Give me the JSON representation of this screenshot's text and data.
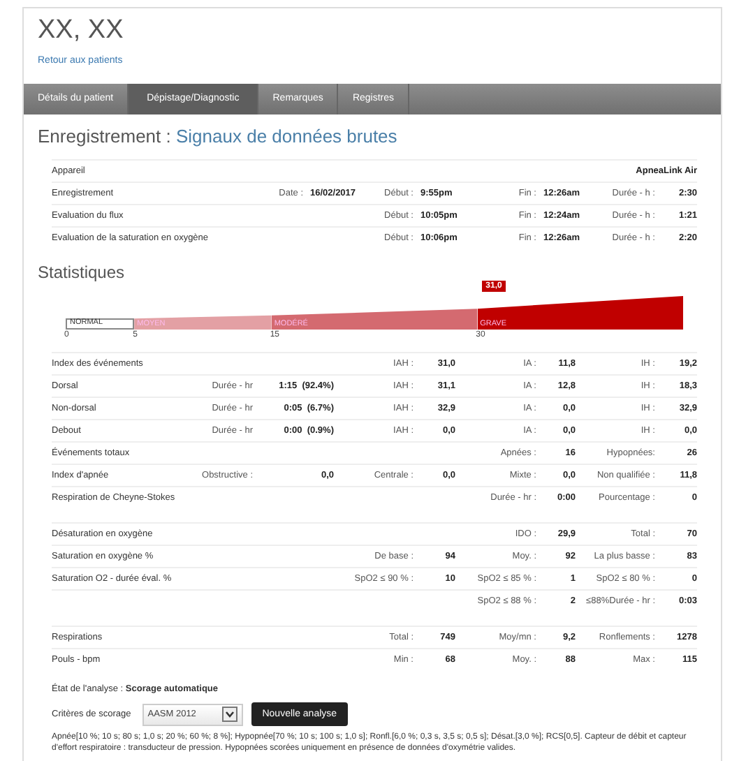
{
  "patient": {
    "name": "XX, XX",
    "back_link": "Retour aux patients"
  },
  "tabs": [
    {
      "label": "Détails du patient",
      "selected": false
    },
    {
      "label": "Dépistage/Diagnostic",
      "selected": true
    },
    {
      "label": "Remarques",
      "selected": false
    },
    {
      "label": "Registres",
      "selected": false
    }
  ],
  "recording": {
    "heading": "Enregistrement :",
    "subtitle": "Signaux de données brutes",
    "rows": [
      {
        "label": "Appareil",
        "columns": {
          "d": {
            "value": "ApneaLink Air"
          }
        }
      },
      {
        "label": "Enregistrement",
        "columns": {
          "a": {
            "key": "Date :",
            "value": "16/02/2017"
          },
          "b": {
            "key": "Début :",
            "value": "9:55pm"
          },
          "c": {
            "key": "Fin :",
            "value": "12:26am"
          },
          "d": {
            "key": "Durée - h :",
            "value": "2:30"
          }
        }
      },
      {
        "label": "Evaluation du flux",
        "columns": {
          "b": {
            "key": "Début :",
            "value": "10:05pm"
          },
          "c": {
            "key": "Fin :",
            "value": "12:24am"
          },
          "d": {
            "key": "Durée - h :",
            "value": "1:21"
          }
        }
      },
      {
        "label": "Evaluation de la saturation en oxygène",
        "columns": {
          "b": {
            "key": "Début :",
            "value": "10:06pm"
          },
          "c": {
            "key": "Fin :",
            "value": "12:26am"
          },
          "d": {
            "key": "Durée - h :",
            "value": "2:20"
          }
        }
      }
    ]
  },
  "statistics": {
    "heading": "Statistiques",
    "severity_scale": {
      "segments": [
        {
          "label": "NORMAL",
          "tick": "0",
          "color": "#ffffff"
        },
        {
          "label": "MOYEN",
          "tick": "5",
          "color": "#e3a0a4"
        },
        {
          "label": "MODÉRÉ",
          "tick": "15",
          "color": "#d46a70"
        },
        {
          "label": "GRAVE",
          "tick": "30",
          "color": "#c00000",
          "marker": "31,0"
        }
      ]
    },
    "groups": [
      {
        "rows": [
          {
            "label": "Index des événements",
            "columns": {
              "b": {
                "key": "IAH :",
                "value": "31,0"
              },
              "c": {
                "key": "IA :",
                "value": "11,8"
              },
              "d": {
                "key": "IH :",
                "value": "19,2"
              }
            }
          },
          {
            "label": "Dorsal",
            "columns": {
              "a": {
                "key": "Durée - hr",
                "value": "1:15  (92.4%)"
              },
              "b": {
                "key": "IAH :",
                "value": "31,1"
              },
              "c": {
                "key": "IA :",
                "value": "12,8"
              },
              "d": {
                "key": "IH :",
                "value": "18,3"
              }
            }
          },
          {
            "label": "Non-dorsal",
            "columns": {
              "a": {
                "key": "Durée - hr",
                "value": "0:05  (6.7%)"
              },
              "b": {
                "key": "IAH :",
                "value": "32,9"
              },
              "c": {
                "key": "IA :",
                "value": "0,0"
              },
              "d": {
                "key": "IH :",
                "value": "32,9"
              }
            }
          },
          {
            "label": "Debout",
            "columns": {
              "a": {
                "key": "Durée - hr",
                "value": "0:00  (0.9%)"
              },
              "b": {
                "key": "IAH :",
                "value": "0,0"
              },
              "c": {
                "key": "IA :",
                "value": "0,0"
              },
              "d": {
                "key": "IH :",
                "value": "0,0"
              }
            }
          },
          {
            "label": "Événements totaux",
            "columns": {
              "c": {
                "key": "Apnées :",
                "value": "16"
              },
              "d": {
                "key": "Hypopnées:",
                "value": "26"
              }
            }
          },
          {
            "label": "Index d'apnée",
            "columns": {
              "a": {
                "key": "Obstructive :",
                "value": "0,0"
              },
              "b": {
                "key": "Centrale :",
                "value": "0,0"
              },
              "c": {
                "key": "Mixte :",
                "value": "0,0"
              },
              "d": {
                "key": "Non qualifiée :",
                "value": "11,8"
              }
            }
          },
          {
            "label": "Respiration de Cheyne-Stokes",
            "columns": {
              "c": {
                "key": "Durée - hr :",
                "value": "0:00"
              },
              "d": {
                "key": "Pourcentage :",
                "value": "0"
              }
            }
          }
        ]
      },
      {
        "rows": [
          {
            "label": "Désaturation en oxygène",
            "columns": {
              "c": {
                "key": "IDO :",
                "value": "29,9"
              },
              "d": {
                "key": "Total :",
                "value": "70"
              }
            }
          },
          {
            "label": "Saturation en oxygène %",
            "columns": {
              "b": {
                "key": "De base :",
                "value": "94"
              },
              "c": {
                "key": "Moy. :",
                "value": "92"
              },
              "d": {
                "key": "La plus basse :",
                "value": "83"
              }
            }
          },
          {
            "label": "Saturation O2 - durée éval. %",
            "columns": {
              "b": {
                "key": "SpO2 ≤ 90 % :",
                "value": "10"
              },
              "c": {
                "key": "SpO2 ≤ 85 % :",
                "value": "1"
              },
              "d": {
                "key": "SpO2 ≤ 80 % :",
                "value": "0"
              }
            }
          },
          {
            "columns": {
              "c": {
                "key": "SpO2 ≤ 88 % :",
                "value": "2"
              },
              "d": {
                "key": "≤88%Durée - hr :",
                "value": "0:03"
              }
            }
          }
        ]
      },
      {
        "rows": [
          {
            "label": "Respirations",
            "columns": {
              "b": {
                "key": "Total :",
                "value": "749"
              },
              "c": {
                "key": "Moy/mn :",
                "value": "9,2"
              },
              "d": {
                "key": "Ronflements :",
                "value": "1278"
              }
            }
          },
          {
            "label": "Pouls - bpm",
            "columns": {
              "b": {
                "key": "Min :",
                "value": "68"
              },
              "c": {
                "key": "Moy. :",
                "value": "88"
              },
              "d": {
                "key": "Max :",
                "value": "115"
              }
            }
          }
        ]
      }
    ]
  },
  "analysis": {
    "status": "État de l'analyse : **Scorage automatique**",
    "criteria_label": "Critères de scorage",
    "criteria_value": "AASM 2012",
    "button": "Nouvelle analyse",
    "details": "Apnée[10 %; 10 s; 80 s; 1,0 s; 20 %; 60 %; 8 %]; Hypopnée[70 %; 10 s; 100 s; 1,0 s]; Ronfl.[6,0 %; 0,3 s, 3,5 s; 0,5 s]; Désat.[3,0 %]; RCS[0,5]. Capteur de débit et capteur d'effort respiratoire : transducteur de pression. Hypopnées scorées uniquement en présence de données d'oxymétrie valides."
  }
}
